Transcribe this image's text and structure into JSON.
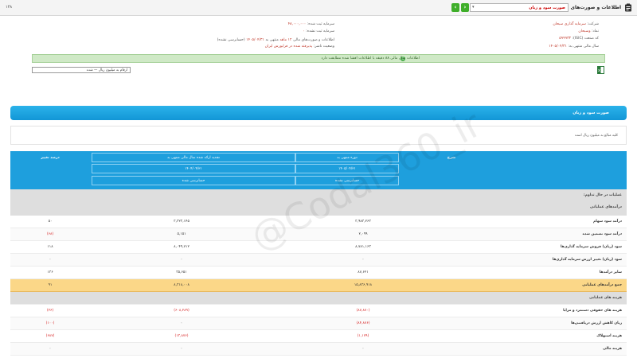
{
  "topbar": {
    "title": "اطلاعات و صورت‌های مالی",
    "report_select": "صورت سود و زیان",
    "prev_label": "‹",
    "next_label": "›",
    "page_no": "۱۳۸"
  },
  "company": {
    "company_label": "شرکت:",
    "company_value": "سرمایه گذاری سبحان",
    "symbol_label": "نماد:",
    "symbol_value": "وسبحان",
    "isic_label": "کد صنعت (ISIC):",
    "isic_value": "۵۹۹۹۳۳",
    "year_end_label": "سال مالی منتهی به:",
    "year_end_value": "۱۴۰۵/۰۴/۳۱",
    "reg_capital_label": "سرمایه ثبت شده:",
    "reg_capital_value": "۴۸,۰۰۰,۰۰۰",
    "unreg_capital_label": "سرمایه ثبت نشده:",
    "unreg_capital_value": "۰",
    "report_label": "اطلاعات و صورت‌های مالی",
    "months": "۱۲ ماهه",
    "period_end_label": "منتهی به",
    "period_end_value": "۱۴۰۵/۰۴/۳۱",
    "audit_status": "(حسابرسی نشده)",
    "status_label": "وضعیت ناشر:",
    "status_value": "پذیرفته شده در فرابورس ایران"
  },
  "alert": {
    "text": "اطلاعات سال مالی ۸۸ دقیقه با اطلاعات افشا شده مطابقت دارد",
    "icon": "info-icon"
  },
  "unit_field": "ارقام به میلیون ریال — شده",
  "panel": {
    "title": "صورت سود و زیان",
    "note": "کلیه مبالغ به میلیون ریال است"
  },
  "table": {
    "header_desc": "شرح",
    "header_change": "درصد تغییر",
    "col1_title": "دوره منتهی به",
    "col1_date": "۱۴۰۵/۰۴/۳۱",
    "col1_audit": "حسابرسی نشده",
    "col2_title": "تجدید ارائه شده سال مالی منتهی به",
    "col2_date": "۱۴۰۴/۰۴/۳۱",
    "col2_audit": "حسابرسی شده",
    "section1": "عملیات در حال تداوم:",
    "section1_sub": "درآمدهای عملیاتی",
    "section2": "هزینه های عملیاتی",
    "rows": [
      {
        "desc": "درآمد سود سهام",
        "c1": "۳,۹۸۳,۲۶۳",
        "c2": "۳,۳۲۳,۱۴۵",
        "c3": "۵۰",
        "c1_neg": false,
        "c2_neg": false,
        "c3_neg": false
      },
      {
        "desc": "درآمد سود تضمین شده",
        "c1": "۲,۰۹۹",
        "c2": "۵,۱۵۱",
        "c3": "(۶۸)",
        "c1_neg": false,
        "c2_neg": false,
        "c3_neg": true
      },
      {
        "desc": "سود (زیان) فروش سرمایه گذاری‌ها",
        "c1": "۸,۷۸۱,۱۶۳",
        "c2": "۸,۰۴۹,۷۱۲",
        "c3": "۱۱۸",
        "c1_neg": false,
        "c2_neg": false,
        "c3_neg": false
      },
      {
        "desc": "سود (زیان) تغییر ارزش سرمایه گذاری‌ها",
        "c1": "۰",
        "c2": "۰",
        "c3": "۰",
        "c1_neg": false,
        "c2_neg": false,
        "c3_neg": false
      },
      {
        "desc": "سایر درآمدها",
        "c1": "۸۷,۶۲۱",
        "c2": "۳۵,۶۵۱",
        "c3": "۱۳۶",
        "c1_neg": false,
        "c2_neg": false,
        "c3_neg": false
      }
    ],
    "total_row": {
      "desc": "جمع درآمدهای عملیاتی",
      "c1": "۱۵,۸۳۶,۹۱۸",
      "c2": "۸,۳۱۸,۰۰۸",
      "c3": "۹۱"
    },
    "expense_rows": [
      {
        "desc": "هزینه های حقوقی دستمزد و مزایا",
        "c1": "(۸۷,۸۷۰)",
        "c2": "(۶۰۸,۲۸۹)",
        "c3": "(۲۶)",
        "c1_neg": true,
        "c2_neg": true,
        "c3_neg": true
      },
      {
        "desc": "زیان کاهش ارزش دریافتنی‌ها",
        "c1": "(۸۴,۸۷۶)",
        "c2": "۰",
        "c3": "(۱۰۰)",
        "c1_neg": true,
        "c2_neg": false,
        "c3_neg": true
      },
      {
        "desc": "هزینه استهلاک",
        "c1": "(۱,۱۷۹)",
        "c2": "(۱۳,۸۷۶)",
        "c3": "(۶۸۷)",
        "c1_neg": true,
        "c2_neg": true,
        "c3_neg": true
      },
      {
        "desc": "هزینه مالی",
        "c1": "۰",
        "c2": "۰",
        "c3": "۰",
        "c1_neg": false,
        "c2_neg": false,
        "c3_neg": false
      }
    ]
  },
  "watermark": "@Codal360_ir",
  "colors": {
    "accent": "#1e9fdd",
    "negative": "#d62020",
    "total_bg": "#fbd788",
    "alert_bg": "#cfe9c6"
  }
}
